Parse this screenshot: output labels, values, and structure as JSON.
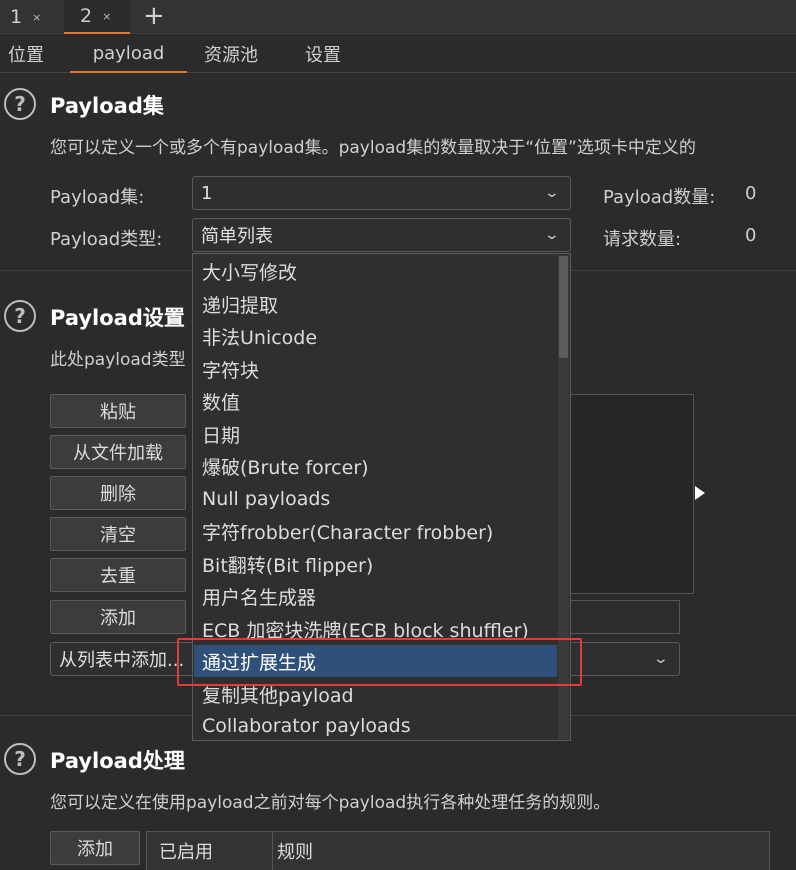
{
  "top_tabs": [
    {
      "label": "1",
      "close": "×"
    },
    {
      "label": "2",
      "close": "×"
    }
  ],
  "new_tab": "+",
  "sub_tabs": [
    "位置",
    "payload",
    "资源池",
    "设置"
  ],
  "payload_sets": {
    "help": "?",
    "title": "Payload集",
    "description": "您可以定义一个或多个有payload集。payload集的数量取决于“位置”选项卡中定义的",
    "set_label": "Payload集:",
    "set_value": "1",
    "type_label": "Payload类型:",
    "type_value": "简单列表",
    "count_label": "Payload数量:",
    "count_value": "0",
    "request_label": "请求数量:",
    "request_value": "0"
  },
  "payload_settings": {
    "help": "?",
    "title": "Payload设置",
    "description": "此处payload类型",
    "buttons": [
      "粘贴",
      "从文件加载",
      "删除",
      "清空",
      "去重"
    ],
    "add_button": "添加",
    "add_from_list": "从列表中添加..."
  },
  "dropdown": {
    "items": [
      "大小写修改",
      "递归提取",
      "非法Unicode",
      "字符块",
      "数值",
      "日期",
      "爆破(Brute forcer)",
      "Null payloads",
      "字符frobber(Character frobber)",
      "Bit翻转(Bit flipper)",
      "用户名生成器",
      "ECB 加密块洗牌(ECB block shuffler)",
      "通过扩展生成",
      "复制其他payload",
      "Collaborator payloads"
    ],
    "selected_index": 12
  },
  "payload_processing": {
    "help": "?",
    "title": "Payload处理",
    "description": "您可以定义在使用payload之前对每个payload执行各种处理任务的规则。",
    "add_button": "添加",
    "columns": [
      "已启用",
      "规则"
    ]
  },
  "colors": {
    "accent": "#e8752b",
    "selection": "#2f5079",
    "highlight_box": "#e03c3c"
  },
  "icons": [
    "chevron-down-icon",
    "help-icon",
    "close-icon",
    "plus-icon",
    "play-arrow-icon"
  ]
}
